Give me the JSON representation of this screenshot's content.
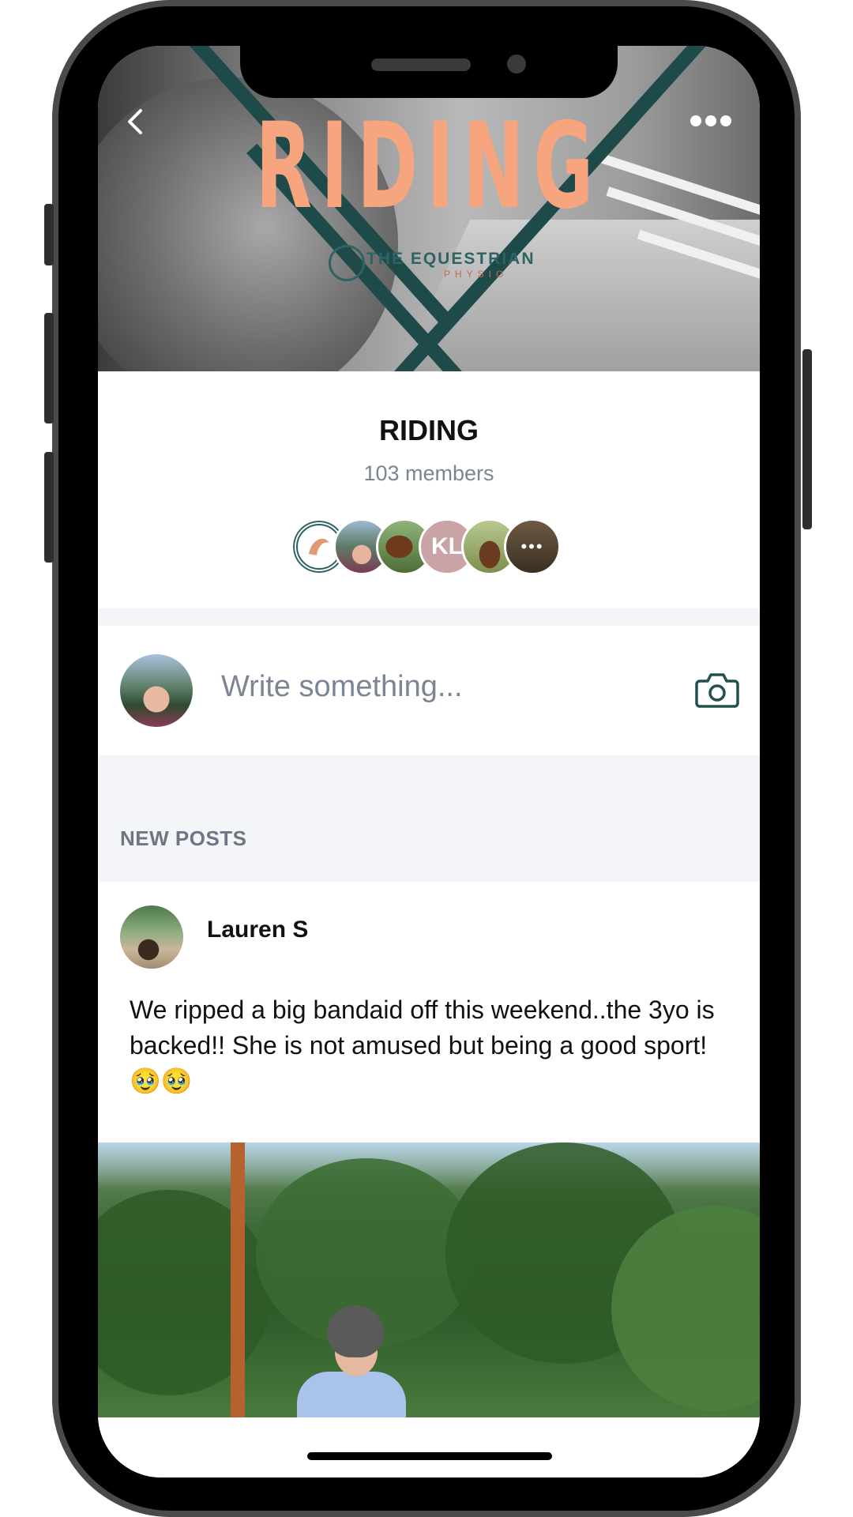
{
  "cover": {
    "title": "RIDING",
    "brand": "THE EQUESTRIAN",
    "brand_sub": "PHYSIO"
  },
  "group": {
    "name": "RIDING",
    "member_count": "103 members",
    "avatars": [
      {
        "type": "logo"
      },
      {
        "type": "photo"
      },
      {
        "type": "photo"
      },
      {
        "type": "initials",
        "text": "KL",
        "color": "#c9a3a5"
      },
      {
        "type": "photo"
      },
      {
        "type": "more",
        "text": "•••"
      }
    ]
  },
  "composer": {
    "placeholder": "Write something..."
  },
  "feed": {
    "section_label": "NEW POSTS",
    "posts": [
      {
        "author": "Lauren S",
        "body": "We ripped a big bandaid off this weekend..the 3yo is backed!! She is not amused but being a good sport! 🥹🥹"
      }
    ]
  },
  "colors": {
    "accent_title": "#f7a57e",
    "brand_teal": "#2f6363",
    "muted_text": "#7b8593",
    "separator": "#f4f5f9"
  },
  "icons": {
    "back": "chevron-left-icon",
    "more": "more-horizontal-icon",
    "camera": "camera-icon"
  }
}
